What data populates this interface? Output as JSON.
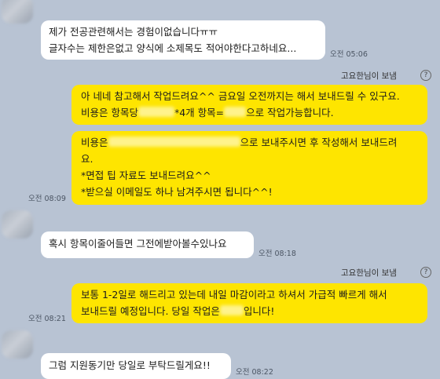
{
  "messages": {
    "m1": {
      "lines": [
        "제가 전공관련해서는 경험이없습니다ㅠㅠ",
        "글자수는 제한은없고 양식에 소제목도 적어야한다고하네요..."
      ],
      "time": "오전 05:06"
    },
    "sender_label": "고요한님이 보냄",
    "help_icon": "?",
    "m2": {
      "line1": "아 네네 참고해서 작업드려요^^ 금요일 오전까지는 해서 보내드릴 수 있구요.",
      "line2_a": "비용은 항목당",
      "line2_b": "*4개 항목=",
      "line2_c": "으로 작업가능합니다."
    },
    "m3": {
      "line1_a": "비용은",
      "line1_b": "으로 보내주시면 후 작성해서 보내드려",
      "line2": "요.",
      "line3": "*면접 팁 자료도 보내드려요^^",
      "line4": "*받으실 이메일도 하나 남겨주시면 됩니다^^!",
      "time": "오전 08:09"
    },
    "m4": {
      "text": "혹시 항목이줄어들면 그전에받아볼수있나요",
      "time": "오전 08:18"
    },
    "m5": {
      "line1": "보통 1-2일로 해드리고 있는데 내일 마감이라고 하셔서 가급적 빠르게 해서",
      "line2_a": "보내드릴 예정입니다. 당일 작업은",
      "line2_b": "입니다!",
      "time": "오전 08:21"
    },
    "m6": {
      "text": "그럼 지원동기만 당일로 부탁드릴게요!!",
      "time": "오전 08:22"
    }
  }
}
